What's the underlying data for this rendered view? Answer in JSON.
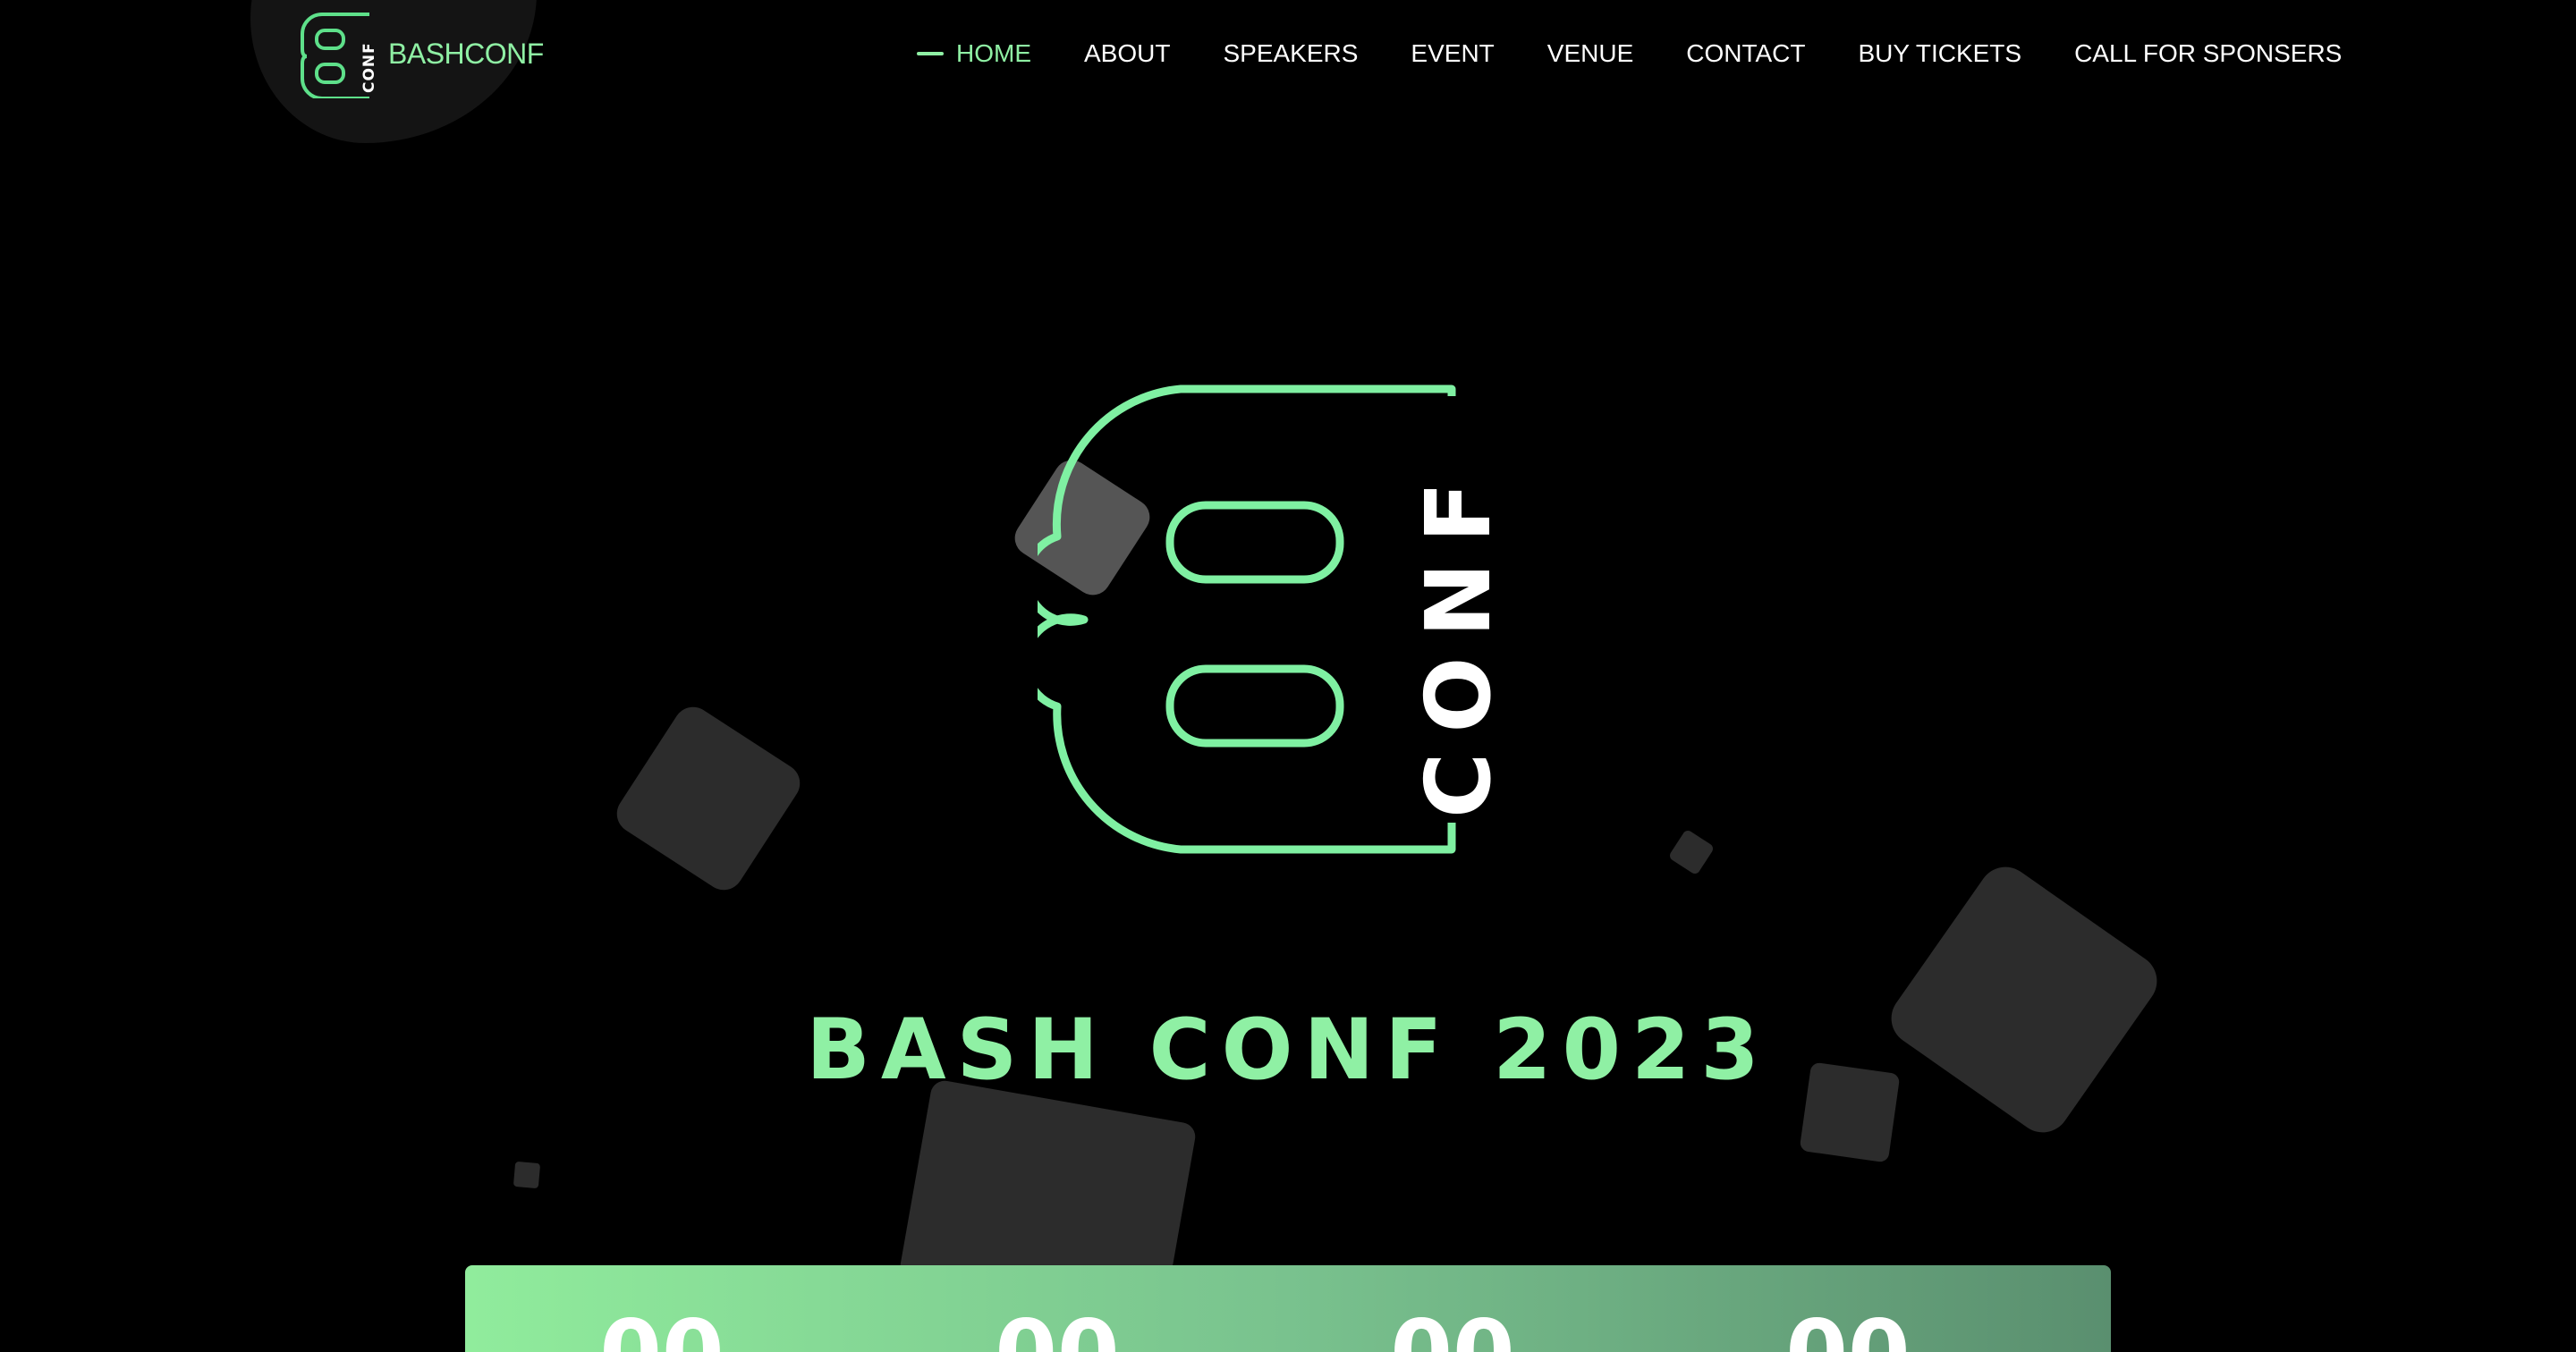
{
  "brand": {
    "name": "BASHCONF",
    "logo_text": "CONF",
    "accent_color": "#8ff0a4"
  },
  "nav": {
    "items": [
      {
        "label": "HOME",
        "active": true
      },
      {
        "label": "ABOUT",
        "active": false
      },
      {
        "label": "SPEAKERS",
        "active": false
      },
      {
        "label": "EVENT",
        "active": false
      },
      {
        "label": "VENUE",
        "active": false
      },
      {
        "label": "CONTACT",
        "active": false
      },
      {
        "label": "BUY TICKETS",
        "active": false
      },
      {
        "label": "CALL FOR SPONSERS",
        "active": false
      }
    ]
  },
  "hero": {
    "logo_text": "CONF",
    "title": "BASH CONF 2023"
  },
  "countdown": {
    "values": [
      "00",
      "00",
      "00",
      "00"
    ]
  },
  "colors": {
    "background": "#000000",
    "accent": "#8ff0a4",
    "shape": "#2c2c2c"
  }
}
